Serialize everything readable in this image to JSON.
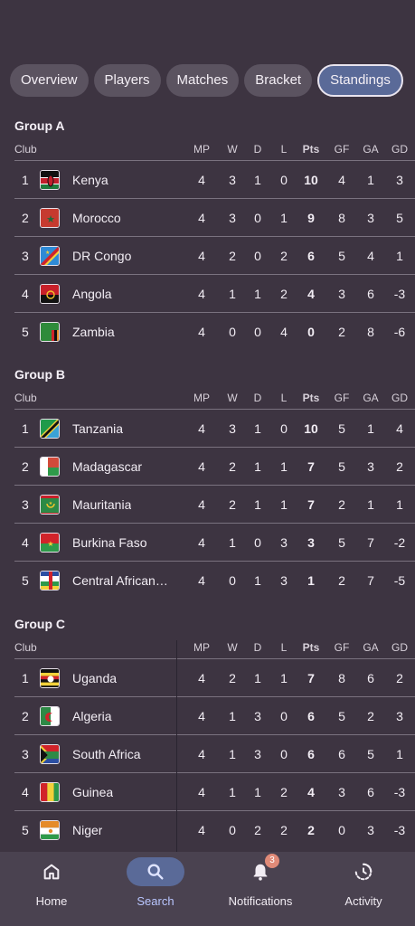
{
  "tabs": [
    {
      "label": "Overview"
    },
    {
      "label": "Players"
    },
    {
      "label": "Matches"
    },
    {
      "label": "Bracket"
    },
    {
      "label": "Standings"
    }
  ],
  "columns": {
    "club": "Club",
    "mp": "MP",
    "w": "W",
    "d": "D",
    "l": "L",
    "pts": "Pts",
    "gf": "GF",
    "ga": "GA",
    "gd": "GD"
  },
  "groups": [
    {
      "title": "Group A",
      "rows": [
        {
          "rank": "1",
          "team": "Kenya",
          "flag": "kenya-flag-icon",
          "mp": "4",
          "w": "3",
          "d": "1",
          "l": "0",
          "pts": "10",
          "gf": "4",
          "ga": "1",
          "gd": "3"
        },
        {
          "rank": "2",
          "team": "Morocco",
          "flag": "morocco-flag-icon",
          "mp": "4",
          "w": "3",
          "d": "0",
          "l": "1",
          "pts": "9",
          "gf": "8",
          "ga": "3",
          "gd": "5"
        },
        {
          "rank": "3",
          "team": "DR Congo",
          "flag": "dr-congo-flag-icon",
          "mp": "4",
          "w": "2",
          "d": "0",
          "l": "2",
          "pts": "6",
          "gf": "5",
          "ga": "4",
          "gd": "1"
        },
        {
          "rank": "4",
          "team": "Angola",
          "flag": "angola-flag-icon",
          "mp": "4",
          "w": "1",
          "d": "1",
          "l": "2",
          "pts": "4",
          "gf": "3",
          "ga": "6",
          "gd": "-3"
        },
        {
          "rank": "5",
          "team": "Zambia",
          "flag": "zambia-flag-icon",
          "mp": "4",
          "w": "0",
          "d": "0",
          "l": "4",
          "pts": "0",
          "gf": "2",
          "ga": "8",
          "gd": "-6"
        }
      ]
    },
    {
      "title": "Group B",
      "rows": [
        {
          "rank": "1",
          "team": "Tanzania",
          "flag": "tanzania-flag-icon",
          "mp": "4",
          "w": "3",
          "d": "1",
          "l": "0",
          "pts": "10",
          "gf": "5",
          "ga": "1",
          "gd": "4"
        },
        {
          "rank": "2",
          "team": "Madagascar",
          "flag": "madagascar-flag-icon",
          "mp": "4",
          "w": "2",
          "d": "1",
          "l": "1",
          "pts": "7",
          "gf": "5",
          "ga": "3",
          "gd": "2"
        },
        {
          "rank": "3",
          "team": "Mauritania",
          "flag": "mauritania-flag-icon",
          "mp": "4",
          "w": "2",
          "d": "1",
          "l": "1",
          "pts": "7",
          "gf": "2",
          "ga": "1",
          "gd": "1"
        },
        {
          "rank": "4",
          "team": "Burkina Faso",
          "flag": "burkina-faso-flag-icon",
          "mp": "4",
          "w": "1",
          "d": "0",
          "l": "3",
          "pts": "3",
          "gf": "5",
          "ga": "7",
          "gd": "-2"
        },
        {
          "rank": "5",
          "team": "Central African…",
          "flag": "central-african-republic-flag-icon",
          "mp": "4",
          "w": "0",
          "d": "1",
          "l": "3",
          "pts": "1",
          "gf": "2",
          "ga": "7",
          "gd": "-5"
        }
      ]
    },
    {
      "title": "Group C",
      "rows": [
        {
          "rank": "1",
          "team": "Uganda",
          "flag": "uganda-flag-icon",
          "mp": "4",
          "w": "2",
          "d": "1",
          "l": "1",
          "pts": "7",
          "gf": "8",
          "ga": "6",
          "gd": "2"
        },
        {
          "rank": "2",
          "team": "Algeria",
          "flag": "algeria-flag-icon",
          "mp": "4",
          "w": "1",
          "d": "3",
          "l": "0",
          "pts": "6",
          "gf": "5",
          "ga": "2",
          "gd": "3"
        },
        {
          "rank": "3",
          "team": "South Africa",
          "flag": "south-africa-flag-icon",
          "mp": "4",
          "w": "1",
          "d": "3",
          "l": "0",
          "pts": "6",
          "gf": "6",
          "ga": "5",
          "gd": "1"
        },
        {
          "rank": "4",
          "team": "Guinea",
          "flag": "guinea-flag-icon",
          "mp": "4",
          "w": "1",
          "d": "1",
          "l": "2",
          "pts": "4",
          "gf": "3",
          "ga": "6",
          "gd": "-3"
        },
        {
          "rank": "5",
          "team": "Niger",
          "flag": "niger-flag-icon",
          "mp": "4",
          "w": "0",
          "d": "2",
          "l": "2",
          "pts": "2",
          "gf": "0",
          "ga": "3",
          "gd": "-3"
        }
      ]
    }
  ],
  "nav": {
    "home": {
      "label": "Home",
      "icon": "home-icon"
    },
    "search": {
      "label": "Search",
      "icon": "search-icon"
    },
    "notifications": {
      "label": "Notifications",
      "icon": "bell-icon",
      "badge": "3"
    },
    "activity": {
      "label": "Activity",
      "icon": "activity-icon"
    }
  },
  "colors": {
    "background": "#3d3441",
    "active_tab": "#5a6a98",
    "badge": "#e08a78"
  }
}
